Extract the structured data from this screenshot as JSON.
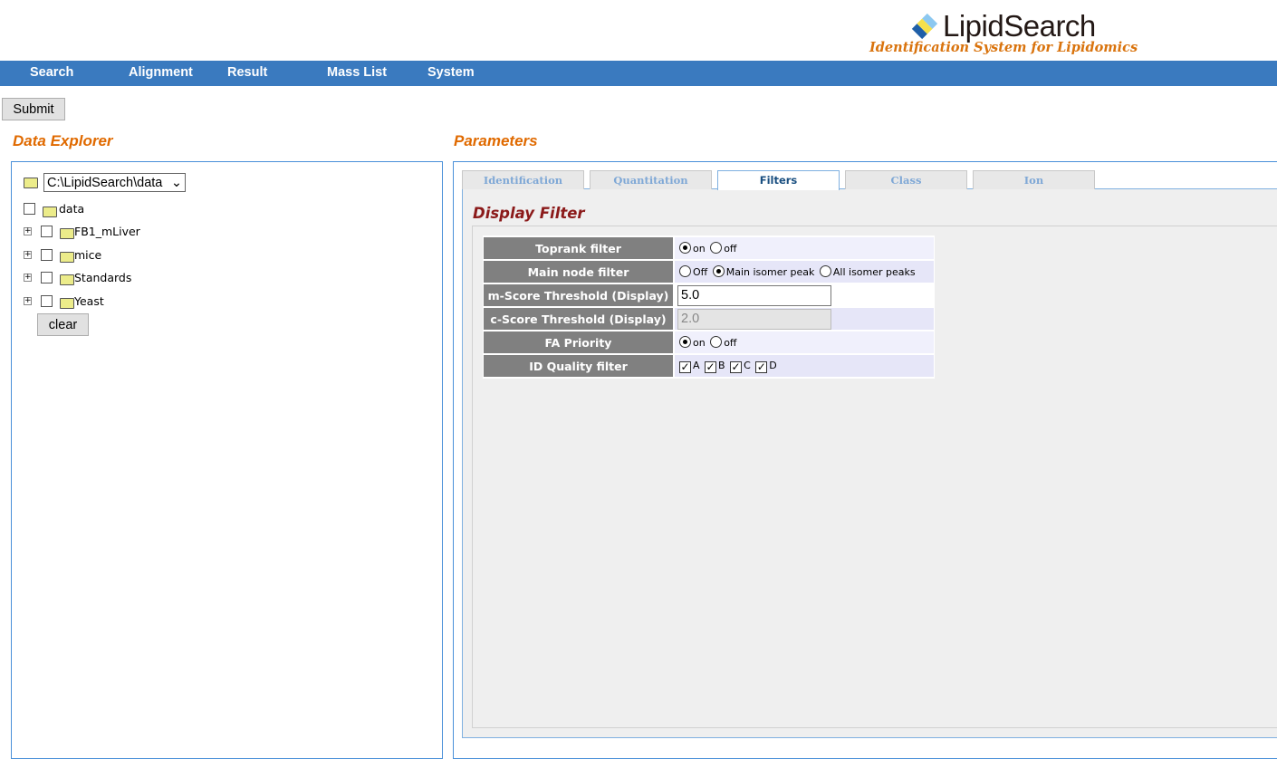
{
  "logo": {
    "name": "LipidSearch",
    "tagline": "Identification System for Lipidomics"
  },
  "nav": [
    "Search",
    "Alignment",
    "Result",
    "Mass List",
    "System"
  ],
  "submit_label": "Submit",
  "explorer": {
    "title": "Data Explorer",
    "path": "C:\\LipidSearch\\data",
    "root": "data",
    "folders": [
      "FB1_mLiver",
      "mice",
      "Standards",
      "Yeast"
    ],
    "clear_label": "clear"
  },
  "parameters": {
    "title": "Parameters",
    "tabs": [
      "Identification",
      "Quantitation",
      "Filters",
      "Class",
      "Ion"
    ],
    "active_tab": "Filters"
  },
  "display_filter": {
    "title": "Display Filter",
    "toprank": {
      "label": "Toprank filter",
      "options": [
        "on",
        "off"
      ],
      "selected": "on"
    },
    "main_node": {
      "label": "Main node filter",
      "options": [
        "Off",
        "Main isomer peak",
        "All isomer peaks"
      ],
      "selected": "Main isomer peak"
    },
    "m_score": {
      "label": "m-Score Threshold (Display)",
      "value": "5.0"
    },
    "c_score": {
      "label": "c-Score Threshold (Display)",
      "value": "2.0",
      "disabled": true
    },
    "fa_priority": {
      "label": "FA Priority",
      "options": [
        "on",
        "off"
      ],
      "selected": "on"
    },
    "id_quality": {
      "label": "ID Quality filter",
      "options": [
        "A",
        "B",
        "C",
        "D"
      ],
      "checked": [
        "A",
        "B",
        "C",
        "D"
      ]
    }
  },
  "colors": {
    "nav": "#3a7abf",
    "section_title": "#e06a00",
    "filter_title": "#8b1a1a",
    "label_bg": "#808080"
  }
}
